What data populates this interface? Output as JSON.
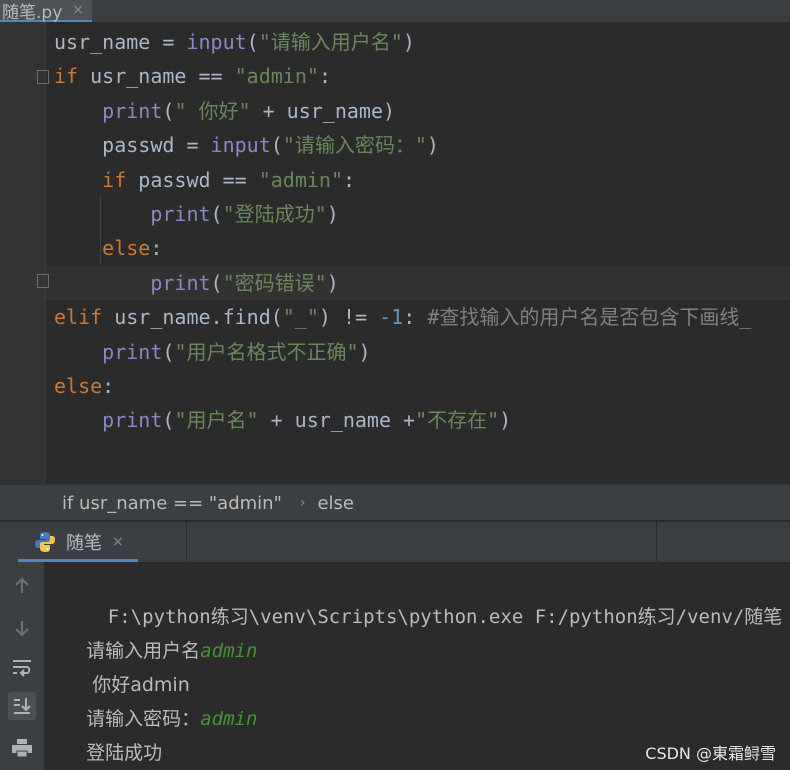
{
  "editor": {
    "tab": {
      "filename": "随笔.py",
      "close": "×"
    },
    "lines": [
      {
        "indent": "",
        "tokens": [
          {
            "t": "usr_name = ",
            "c": ""
          },
          {
            "t": "input",
            "c": "fn"
          },
          {
            "t": "(",
            "c": ""
          },
          {
            "t": "\"请输入用户名\"",
            "c": "str"
          },
          {
            "t": ")",
            "c": ""
          }
        ]
      },
      {
        "indent": "",
        "tokens": [
          {
            "t": "if",
            "c": "kw"
          },
          {
            "t": " usr_name == ",
            "c": ""
          },
          {
            "t": "\"admin\"",
            "c": "str"
          },
          {
            "t": ":",
            "c": ""
          }
        ]
      },
      {
        "indent": "    ",
        "tokens": [
          {
            "t": "print",
            "c": "fn"
          },
          {
            "t": "(",
            "c": ""
          },
          {
            "t": "\" 你好\"",
            "c": "str"
          },
          {
            "t": " + usr_name)",
            "c": ""
          }
        ]
      },
      {
        "indent": "    ",
        "tokens": [
          {
            "t": "passwd = ",
            "c": ""
          },
          {
            "t": "input",
            "c": "fn"
          },
          {
            "t": "(",
            "c": ""
          },
          {
            "t": "\"请输入密码：\"",
            "c": "str"
          },
          {
            "t": ")",
            "c": ""
          }
        ]
      },
      {
        "indent": "    ",
        "tokens": [
          {
            "t": "if",
            "c": "kw"
          },
          {
            "t": " passwd == ",
            "c": ""
          },
          {
            "t": "\"admin\"",
            "c": "str"
          },
          {
            "t": ":",
            "c": ""
          }
        ]
      },
      {
        "indent": "        ",
        "tokens": [
          {
            "t": "print",
            "c": "fn"
          },
          {
            "t": "(",
            "c": ""
          },
          {
            "t": "\"登陆成功\"",
            "c": "str"
          },
          {
            "t": ")",
            "c": ""
          }
        ]
      },
      {
        "indent": "    ",
        "tokens": [
          {
            "t": "else",
            "c": "kw"
          },
          {
            "t": ":",
            "c": ""
          }
        ]
      },
      {
        "indent": "        ",
        "tokens": [
          {
            "t": "print",
            "c": "fn"
          },
          {
            "t": "(",
            "c": ""
          },
          {
            "t": "\"密码错误\"",
            "c": "str"
          },
          {
            "t": ")",
            "c": ""
          }
        ]
      },
      {
        "indent": "",
        "tokens": [
          {
            "t": "elif",
            "c": "kw"
          },
          {
            "t": " usr_name.find(",
            "c": ""
          },
          {
            "t": "\"_\"",
            "c": "str"
          },
          {
            "t": ") != ",
            "c": ""
          },
          {
            "t": "-1",
            "c": "num"
          },
          {
            "t": ": ",
            "c": ""
          },
          {
            "t": "#查找输入的用户名是否包含下画线_",
            "c": "cmt"
          }
        ]
      },
      {
        "indent": "    ",
        "tokens": [
          {
            "t": "print",
            "c": "fn"
          },
          {
            "t": "(",
            "c": ""
          },
          {
            "t": "\"用户名格式不正确\"",
            "c": "str"
          },
          {
            "t": ")",
            "c": ""
          }
        ]
      },
      {
        "indent": "",
        "tokens": [
          {
            "t": "else",
            "c": "kw"
          },
          {
            "t": ":",
            "c": ""
          }
        ]
      },
      {
        "indent": "    ",
        "tokens": [
          {
            "t": "print",
            "c": "fn"
          },
          {
            "t": "(",
            "c": ""
          },
          {
            "t": "\"用户名\"",
            "c": "str"
          },
          {
            "t": " + usr_name +",
            "c": ""
          },
          {
            "t": "\"不存在\"",
            "c": "str"
          },
          {
            "t": ")",
            "c": ""
          }
        ]
      }
    ]
  },
  "breadcrumb": {
    "items": [
      "if usr_name == \"admin\"",
      "else"
    ],
    "separator": "›"
  },
  "run": {
    "tab": {
      "label": "随笔",
      "close": "×"
    },
    "toolbar_icons": [
      "arrow-up-icon",
      "arrow-down-icon",
      "soft-wrap-icon",
      "scroll-to-end-icon",
      "print-icon"
    ],
    "console": [
      {
        "text": "F:\\python练习\\venv\\Scripts\\python.exe F:/python练习/venv/随笔",
        "input": ""
      },
      {
        "text": "请输入用户名",
        "input": "admin"
      },
      {
        "text": " 你好admin",
        "input": ""
      },
      {
        "text": "请输入密码：",
        "input": "admin"
      },
      {
        "text": "登陆成功",
        "input": ""
      }
    ]
  },
  "watermark": "CSDN @東霜鲟雪",
  "colors": {
    "keyword": "#cc7832",
    "builtin": "#8888c6",
    "string": "#6a8759",
    "number": "#6897bb",
    "comment": "#808080",
    "input_echo": "#4a8f3b",
    "accent": "#4a88c7"
  }
}
